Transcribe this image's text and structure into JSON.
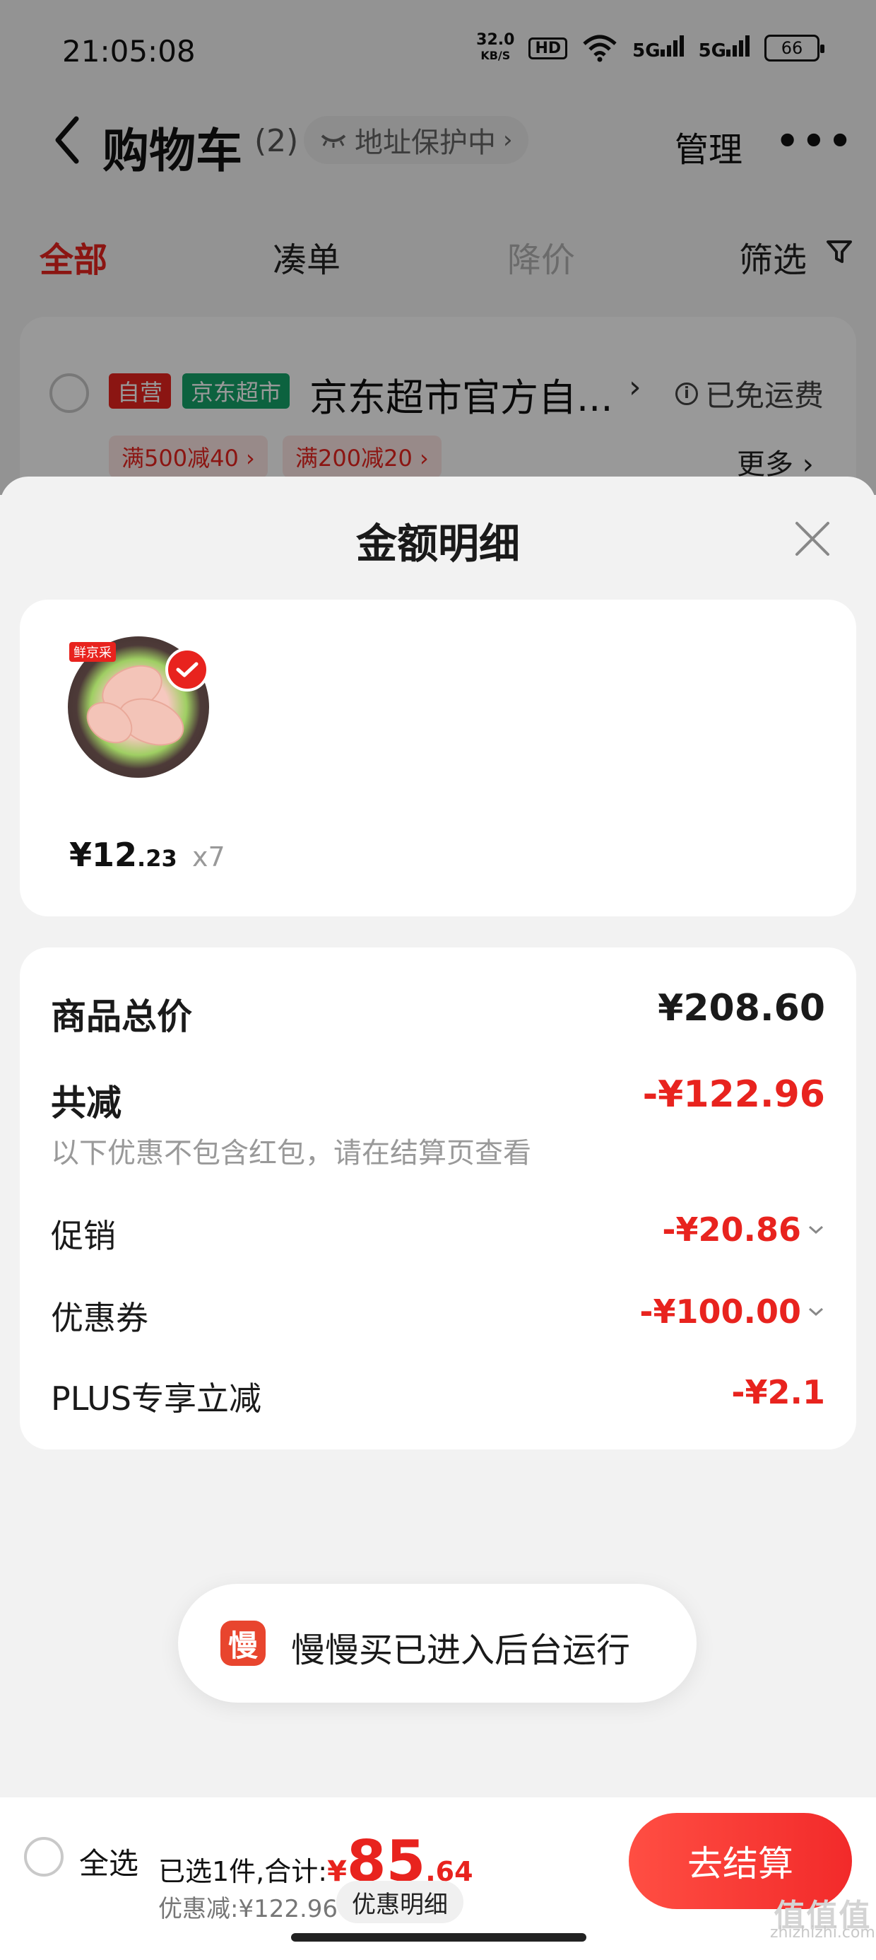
{
  "status_bar": {
    "time": "21:05:08",
    "speed_value": "32.0",
    "speed_unit": "KB/S",
    "hd_label": "HD",
    "signal1": "5G",
    "signal2": "5G",
    "battery": "66"
  },
  "nav": {
    "title": "购物车",
    "count": "(2)",
    "address_pill": "地址保护中",
    "manage": "管理",
    "more": "•••"
  },
  "tabs": [
    {
      "label": "全部",
      "state": "active"
    },
    {
      "label": "凑单",
      "state": "normal"
    },
    {
      "label": "降价",
      "state": "disabled"
    },
    {
      "label": "筛选",
      "state": "normal"
    }
  ],
  "store": {
    "tag_self": "自营",
    "tag_market": "京东超市",
    "name": "京东超市官方自...",
    "free_shipping": "已免运费",
    "coupons": [
      "满500减40 ›",
      "满200减20 ›"
    ],
    "more": "更多 ›"
  },
  "sheet": {
    "title": "金额明细",
    "product": {
      "brand_tag": "鲜京采",
      "price_symbol": "¥",
      "price_int": "12",
      "price_dec": ".23",
      "qty": "x7"
    },
    "details": {
      "total_label": "商品总价",
      "total_value": "¥208.60",
      "reduce_label": "共减",
      "reduce_value": "-¥122.96",
      "hint": "以下优惠不包含红包，请在结算页查看",
      "promo_label": "促销",
      "promo_value": "-¥20.86",
      "coupon_label": "优惠券",
      "coupon_value": "-¥100.00",
      "plus_label": "PLUS专享立减",
      "plus_value": "-¥2.1"
    }
  },
  "toast": {
    "icon_char": "慢",
    "text": "慢慢买已进入后台运行"
  },
  "bottom": {
    "select_all": "全选",
    "selected_text": "已选1件,合计:",
    "total_symbol": "¥",
    "total_int": "85",
    "total_dec": ".64",
    "discount_text": "优惠减:¥122.96",
    "detail_pill": "优惠明细",
    "checkout": "去结算",
    "watermark_big": "值值值",
    "watermark_small": "zhizhizhi.com"
  },
  "colors": {
    "accent_red": "#e8231e",
    "market_green": "#14a36a",
    "checkout_gradient_start": "#ff4e43",
    "checkout_gradient_end": "#f22a2a"
  }
}
